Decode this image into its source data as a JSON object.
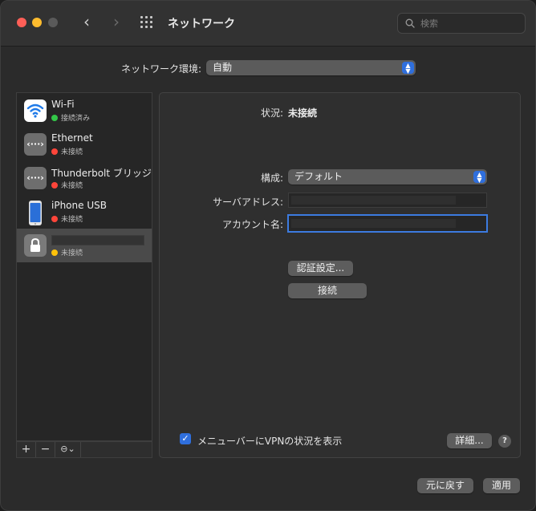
{
  "titlebar": {
    "title": "ネットワーク",
    "back_icon": "chevron-left-icon",
    "forward_icon": "chevron-right-icon",
    "grid_icon": "show-all-grid-icon",
    "search_placeholder": "検索"
  },
  "location": {
    "label": "ネットワーク環境:",
    "value": "自動"
  },
  "services": [
    {
      "name": "Wi-Fi",
      "status": "接続済み",
      "status_color": "#33c748",
      "icon": "wifi-icon"
    },
    {
      "name": "Ethernet",
      "status": "未接続",
      "status_color": "#ff453a",
      "icon": "ethernet-icon"
    },
    {
      "name": "Thunderbolt ブリッジ",
      "status": "未接続",
      "status_color": "#ff453a",
      "icon": "thunderbolt-bridge-icon"
    },
    {
      "name": "iPhone USB",
      "status": "未接続",
      "status_color": "#ff453a",
      "icon": "iphone-icon"
    },
    {
      "name": "",
      "status": "未接続",
      "status_color": "#ffc20a",
      "icon": "vpn-lock-icon"
    }
  ],
  "sidebar_tools": {
    "add": "+",
    "remove": "−",
    "action": "⊖⌄"
  },
  "detail": {
    "status_label": "状況:",
    "status_value": "未接続",
    "config_label": "構成:",
    "config_value": "デフォルト",
    "server_label": "サーバアドレス:",
    "account_label": "アカウント名:",
    "auth_button": "認証設定...",
    "connect_button": "接続",
    "menubar_checkbox_label": "メニューバーにVPNの状況を表示",
    "advanced_button": "詳細...",
    "help_label": "?"
  },
  "footer": {
    "revert_button": "元に戻す",
    "apply_button": "適用"
  },
  "colors": {
    "accent": "#2f6fdd",
    "window_bg": "#2b2b2b"
  }
}
